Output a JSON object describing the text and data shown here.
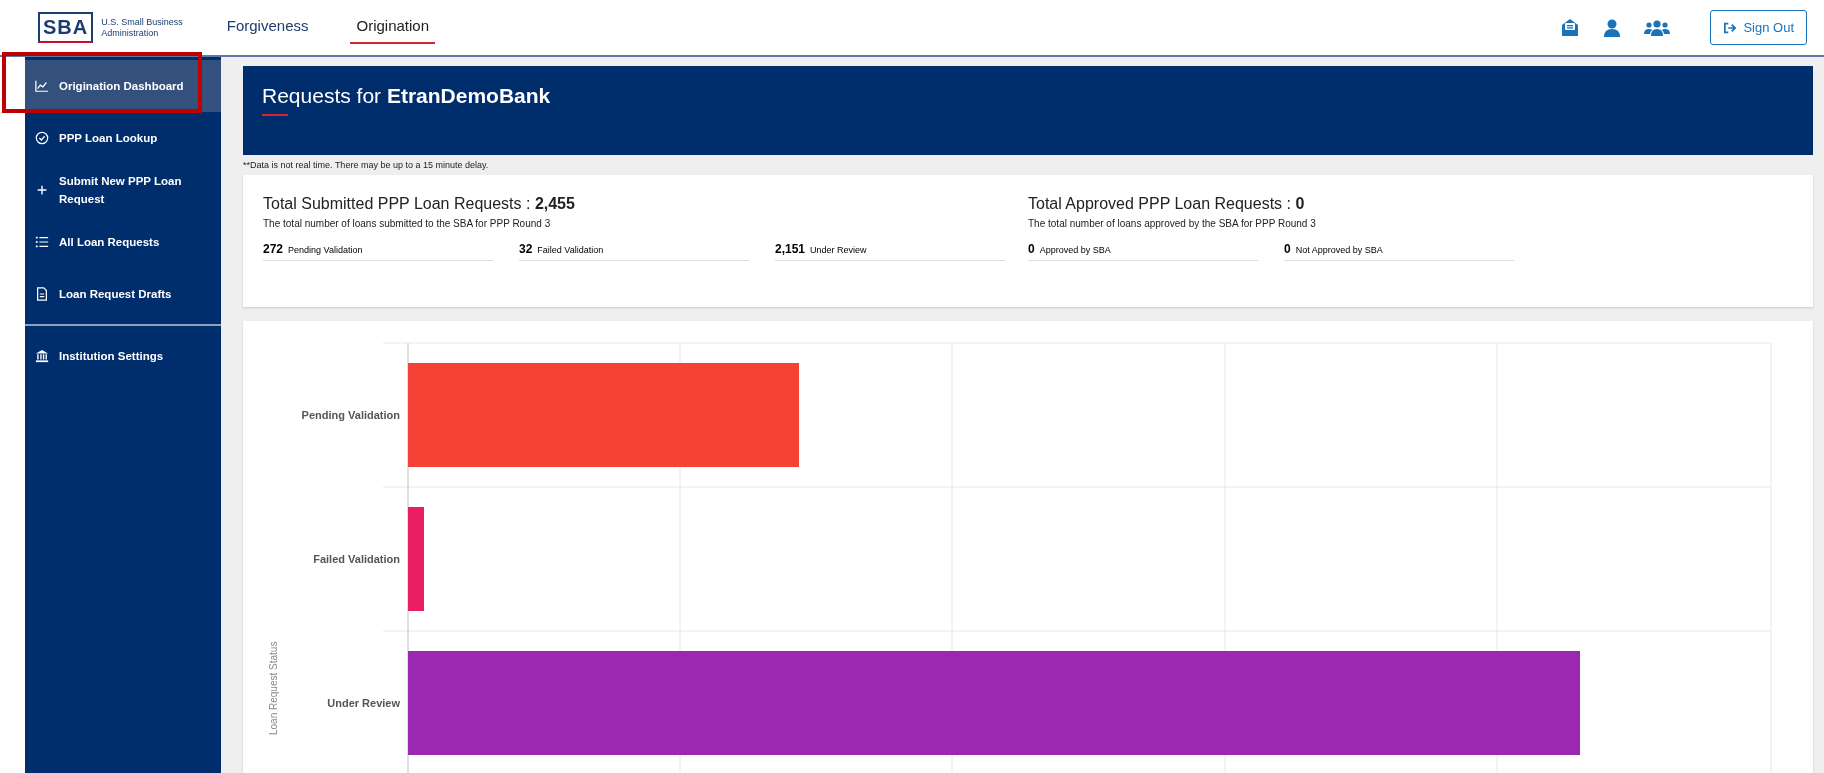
{
  "header": {
    "logo": {
      "mark": "SBA",
      "agency_line_1": "U.S. Small Business",
      "agency_line_2": "Administration"
    },
    "nav": [
      {
        "label": "Forgiveness",
        "selected": false
      },
      {
        "label": "Origination",
        "selected": true
      }
    ],
    "sign_out": "Sign Out"
  },
  "sidebar": {
    "items": [
      {
        "label": "Origination Dashboard",
        "selected": true
      },
      {
        "label": "PPP Loan Lookup",
        "selected": false
      },
      {
        "label": "Submit New PPP Loan Request",
        "selected": false
      },
      {
        "label": "All Loan Requests",
        "selected": false
      },
      {
        "label": "Loan Request Drafts",
        "selected": false
      }
    ],
    "settings": {
      "label": "Institution Settings",
      "selected": false
    }
  },
  "banner": {
    "title": "Requests for **EtranDemoBank**"
  },
  "note": "**Data is not real time. There may be up to a 15 minute delay.",
  "stats": [
    {
      "title": "Total Submitted PPP Loan Requests : ",
      "total": "2,455",
      "subtitle": "The total number of loans submitted to the SBA for PPP Round 3",
      "breakdown": [
        {
          "value": "272",
          "label": "Pending Validation"
        },
        {
          "value": "32",
          "label": "Failed Validation"
        },
        {
          "value": "2,151",
          "label": "Under Review"
        }
      ]
    },
    {
      "title": "Total Approved PPP Loan Requests : ",
      "total": "0",
      "subtitle": "The total number of loans approved by the SBA for PPP Round 3",
      "breakdown": [
        {
          "value": "0",
          "label": "Approved by SBA"
        },
        {
          "value": "0",
          "label": "Not Approved by SBA"
        }
      ]
    }
  ],
  "chart": {
    "ylabel": "Loan Request Status",
    "bars": [
      {
        "label": "Pending Validation",
        "color": "#f44336"
      },
      {
        "label": "Failed Validation",
        "color": "#e91e63"
      },
      {
        "label": "Under Review",
        "color": "#9c27b0"
      }
    ]
  }
}
